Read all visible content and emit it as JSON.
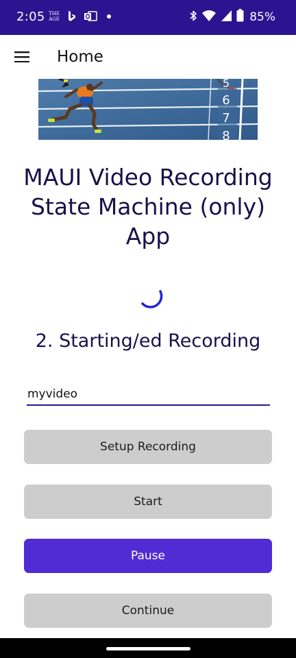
{
  "status_bar": {
    "time": "2:05",
    "battery": "85%",
    "background": "#2b1490",
    "icons": [
      "the-age-icon",
      "bing-icon",
      "outlook-icon",
      "notification-dot-icon",
      "bluetooth-icon",
      "wifi-icon",
      "cell-signal-icon",
      "battery-icon"
    ],
    "age_logo_top": "THE",
    "age_logo_bottom": "AGE"
  },
  "app_bar": {
    "title": "Home",
    "menu_icon": "hamburger-menu-icon"
  },
  "banner": {
    "description_icon": "sprinters-image",
    "lane_numbers": [
      "5",
      "6",
      "7",
      "8"
    ]
  },
  "main": {
    "headline": "MAUI Video Recording State Machine (only) App",
    "state_label": "2. Starting/ed Recording",
    "filename_value": "myvideo"
  },
  "buttons": {
    "setup": "Setup Recording",
    "start": "Start",
    "pause": "Pause",
    "continue": "Continue"
  },
  "colors": {
    "accent": "#512bd4",
    "text_dark": "#17114a",
    "button_gray": "#cdcdcd"
  }
}
